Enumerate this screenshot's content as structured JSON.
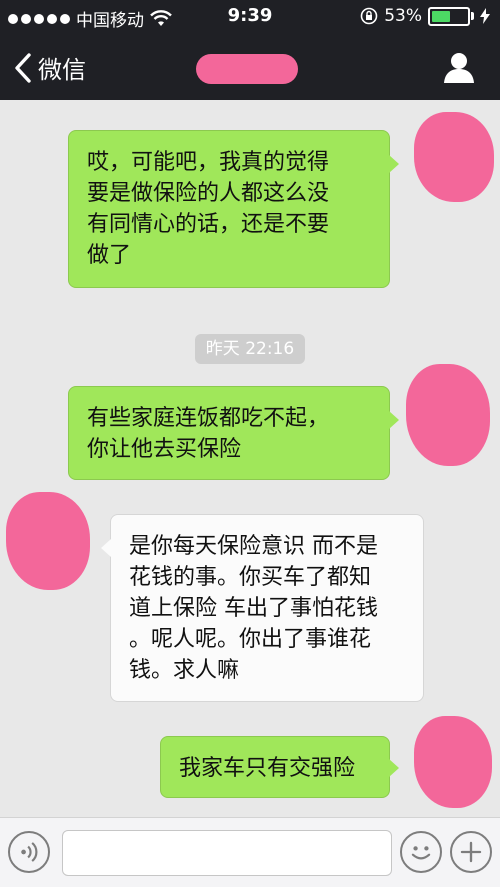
{
  "status_bar": {
    "carrier": "中国移动",
    "time": "9:39",
    "battery_text": "53%",
    "battery_level": 0.53,
    "signal_dots": 5,
    "colors": {
      "battery": "#4cd964"
    }
  },
  "nav": {
    "back_label": "微信",
    "back_icon": "chevron-left-icon",
    "contact_icon": "person-icon"
  },
  "messages": [
    {
      "sender": "me",
      "text": "哎，可能吧，我真的觉得\n要是做保险的人都这么没\n有同情心的话，还是不要\n做了"
    },
    {
      "sender": "me",
      "text": "有些家庭连饭都吃不起，\n你让他去买保险"
    },
    {
      "sender": "other",
      "text": "是你每天保险意识 而不是\n花钱的事。你买车了都知\n道上保险 车出了事怕花钱\n。呢人呢。你出了事谁花\n钱。求人嘛"
    },
    {
      "sender": "me",
      "text": "我家车只有交强险"
    }
  ],
  "timestamp": "昨天 22:16",
  "input_bar": {
    "voice_icon": "voice-icon",
    "emoji_icon": "emoji-icon",
    "plus_icon": "plus-icon",
    "input_value": ""
  },
  "colors": {
    "me_bubble": "#a0e75a",
    "other_bubble": "#fbfbfb",
    "header": "#1f2025",
    "chat_bg": "#e8e8e8",
    "redaction": "#f3679a"
  }
}
